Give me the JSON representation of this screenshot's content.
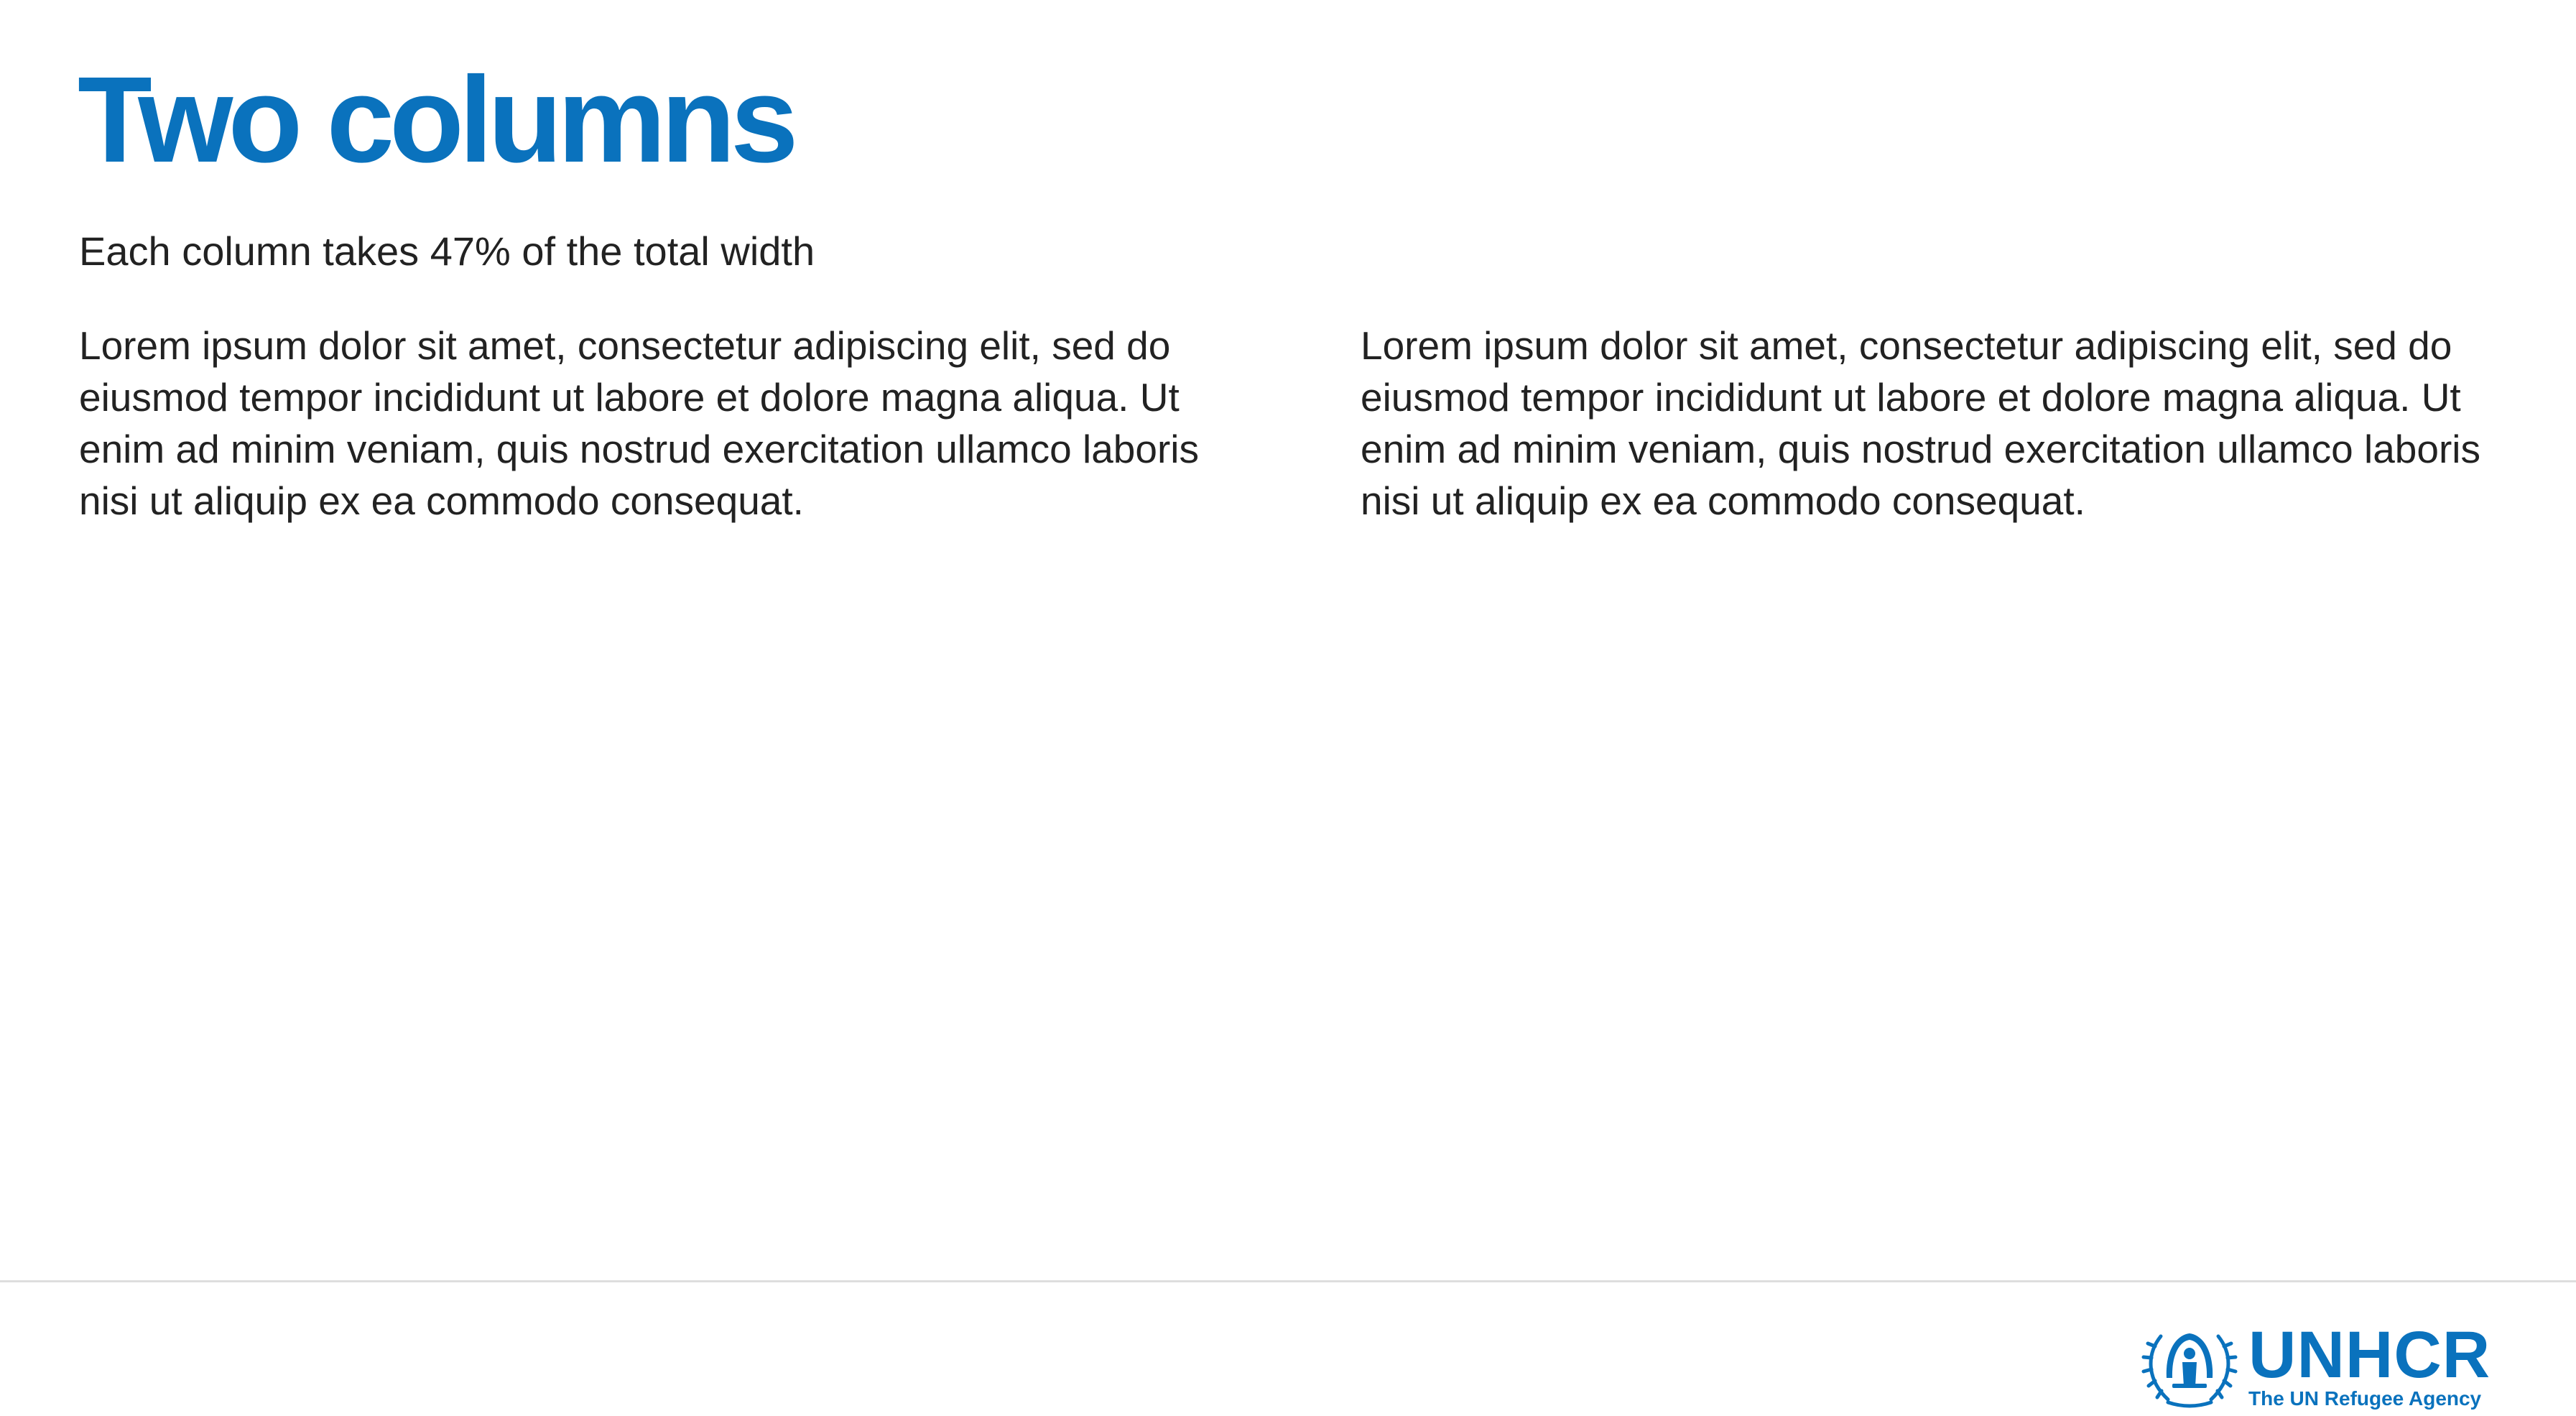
{
  "slide": {
    "title": "Two columns",
    "subtitle": "Each column takes 47% of the total width",
    "columns": [
      {
        "text": "Lorem ipsum dolor sit amet, consectetur adipiscing elit, sed do eiusmod tempor incididunt ut labore et dolore magna aliqua. Ut enim ad minim veniam, quis nostrud exercitation ullamco laboris nisi ut aliquip ex ea commodo consequat."
      },
      {
        "text": "Lorem ipsum dolor sit amet, consectetur adipiscing elit, sed do eiusmod tempor incididunt ut labore et dolore magna aliqua. Ut enim ad minim veniam, quis nostrud exercitation ullamco laboris nisi ut aliquip ex ea commodo consequat."
      }
    ]
  },
  "footer": {
    "logo": {
      "icon": "unhcr-emblem-icon",
      "name": "UNHCR",
      "tagline": "The UN Refugee Agency"
    }
  },
  "colors": {
    "accent": "#0a72bd",
    "text": "#222222",
    "rule": "#dedede",
    "background": "#ffffff"
  }
}
